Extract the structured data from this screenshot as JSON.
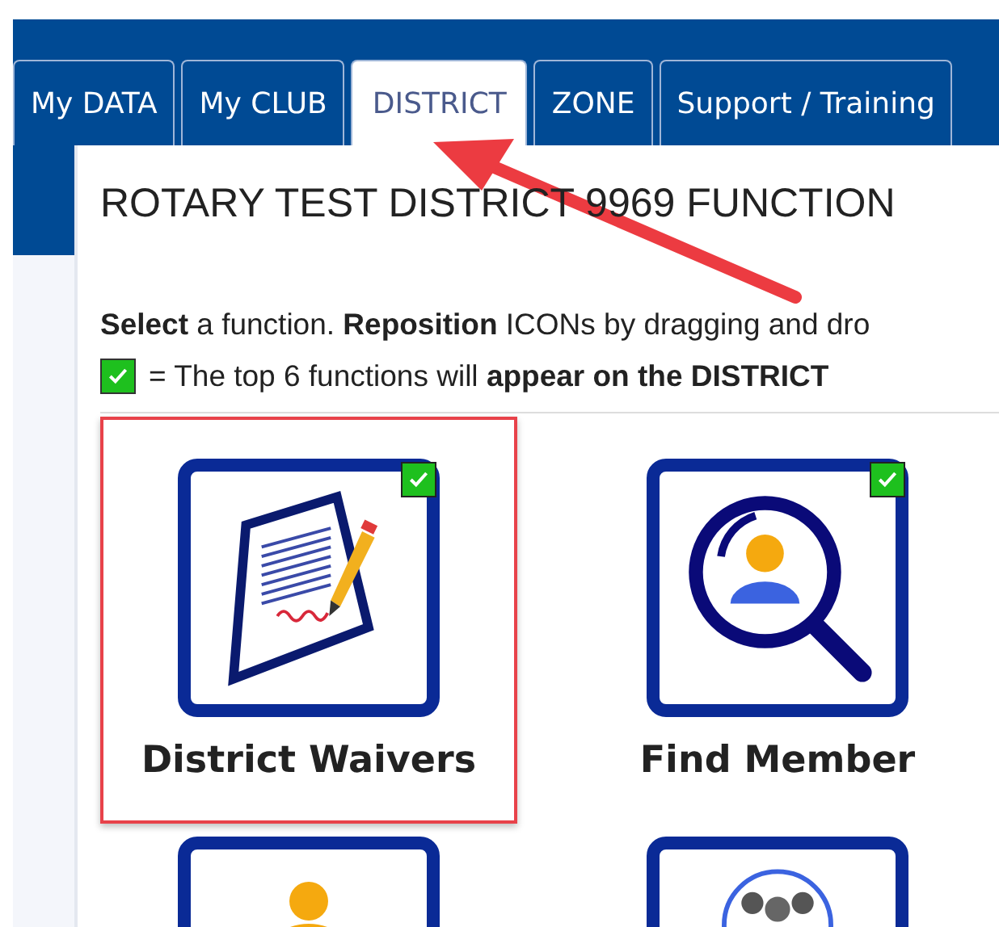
{
  "tabs": [
    {
      "label": "My DATA",
      "selected": false
    },
    {
      "label": "My CLUB",
      "selected": false
    },
    {
      "label": "DISTRICT",
      "selected": true
    },
    {
      "label": "ZONE",
      "selected": false
    },
    {
      "label": "Support / Training",
      "selected": false
    }
  ],
  "title": "ROTARY TEST DISTRICT 9969 FUNCTION",
  "instructions": [
    {
      "kind": "text",
      "text": "**Select** a function. **Reposition** ICONs by dragging and dro"
    },
    {
      "kind": "legend",
      "checked": true,
      "text": "= The top 6 functions will **appear on the DISTRICT**"
    }
  ],
  "tiles": [
    {
      "kind": "document",
      "label": "District Waivers",
      "checked": true,
      "selected": true
    },
    {
      "kind": "search-person",
      "label": "Find Member",
      "checked": true,
      "selected": false
    },
    {
      "kind": "person",
      "checked": false,
      "selected": false
    },
    {
      "kind": "group",
      "checked": false,
      "selected": false
    }
  ]
}
